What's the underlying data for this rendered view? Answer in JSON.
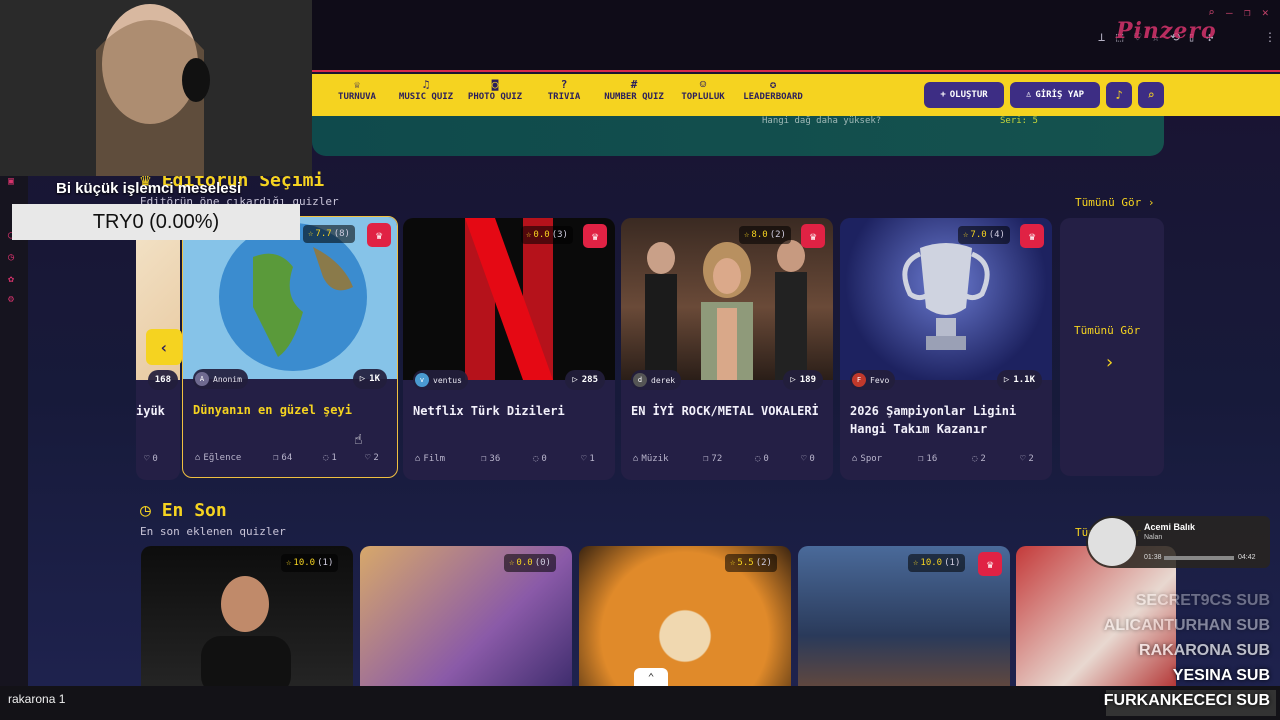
{
  "site": {
    "logo_text": "Pinzero",
    "accent": "#f5d320",
    "nav_bg": "#f5d320",
    "nav_items": [
      {
        "label": "TURNUVA",
        "icon": "trophy-icon"
      },
      {
        "label": "MUSIC QUIZ",
        "icon": "music-note-icon"
      },
      {
        "label": "PHOTO QUIZ",
        "icon": "camera-icon"
      },
      {
        "label": "TRIVIA",
        "icon": "question-icon"
      },
      {
        "label": "NUMBER QUIZ",
        "icon": "hash-icon"
      },
      {
        "label": "TOPLULUK",
        "icon": "users-icon"
      },
      {
        "label": "LEADERBOARD",
        "icon": "medal-icon"
      }
    ],
    "create_label": "OLUŞTUR",
    "login_label": "GİRİŞ YAP",
    "hero_question": "Hangi dağ daha yüksek?",
    "hero_series": "Seri: 5"
  },
  "editor": {
    "title": "Editörün Seçimi",
    "subtitle": "Editörün öne çıkardığı quizler",
    "see_all": "Tümünü Gör",
    "see_all_card": "Tümünü Gör",
    "partial_card": {
      "plays": "168",
      "title": "iyük",
      "likes": "0"
    },
    "cards": [
      {
        "rating": "7.7",
        "count": "(8)",
        "author": "Anonim",
        "avatar": "A",
        "plays": "1K",
        "title": "Dünyanın en güzel şeyi",
        "category": "Eğlence",
        "questions": "64",
        "comments": "1",
        "likes": "2",
        "image": "globe"
      },
      {
        "rating": "0.0",
        "count": "(3)",
        "author": "ventus",
        "avatar": "v",
        "plays": "285",
        "title": "Netflix Türk Dizileri",
        "category": "Film",
        "questions": "36",
        "comments": "0",
        "likes": "1",
        "image": "netflix"
      },
      {
        "rating": "8.0",
        "count": "(2)",
        "author": "derek",
        "avatar": "d",
        "plays": "189",
        "title": "EN İYİ ROCK/METAL VOKALERİ",
        "category": "Müzik",
        "questions": "72",
        "comments": "0",
        "likes": "0",
        "image": "rock-band"
      },
      {
        "rating": "7.0",
        "count": "(4)",
        "author": "Fevo",
        "avatar": "F",
        "plays": "1.1K",
        "title": "2026 Şampiyonlar Ligini Hangi Takım Kazanır",
        "category": "Spor",
        "questions": "16",
        "comments": "2",
        "likes": "2",
        "image": "trophy"
      }
    ]
  },
  "latest": {
    "title": "En Son",
    "subtitle": "En son eklenen quizler",
    "see_all": "Tümünü Gör",
    "cards": [
      {
        "rating": "10.0",
        "count": "(1)",
        "image": "man-speaking",
        "crown": false
      },
      {
        "rating": "0.0",
        "count": "(0)",
        "image": "game-heroes",
        "crown": false
      },
      {
        "rating": "5.5",
        "count": "(2)",
        "image": "tiger",
        "crown": false
      },
      {
        "rating": "10.0",
        "count": "(1)",
        "image": "tv-show",
        "crown": true
      }
    ]
  },
  "overlay": {
    "notice_title": "Bi küçük işlemci meselesi",
    "notice_value": "TRY0 (0.00%)",
    "chat_user": "rakarona",
    "chat_text": "1",
    "player_song": "Acemi Balık",
    "player_artist": "Nalan",
    "player_elapsed": "01:38",
    "player_total": "04:42",
    "subs": [
      "SECRET9CS SUB",
      "ALICANTURHAN SUB",
      "RAKARONA SUB",
      "YESINA SUB",
      "FURKANKECECI SUB"
    ]
  }
}
